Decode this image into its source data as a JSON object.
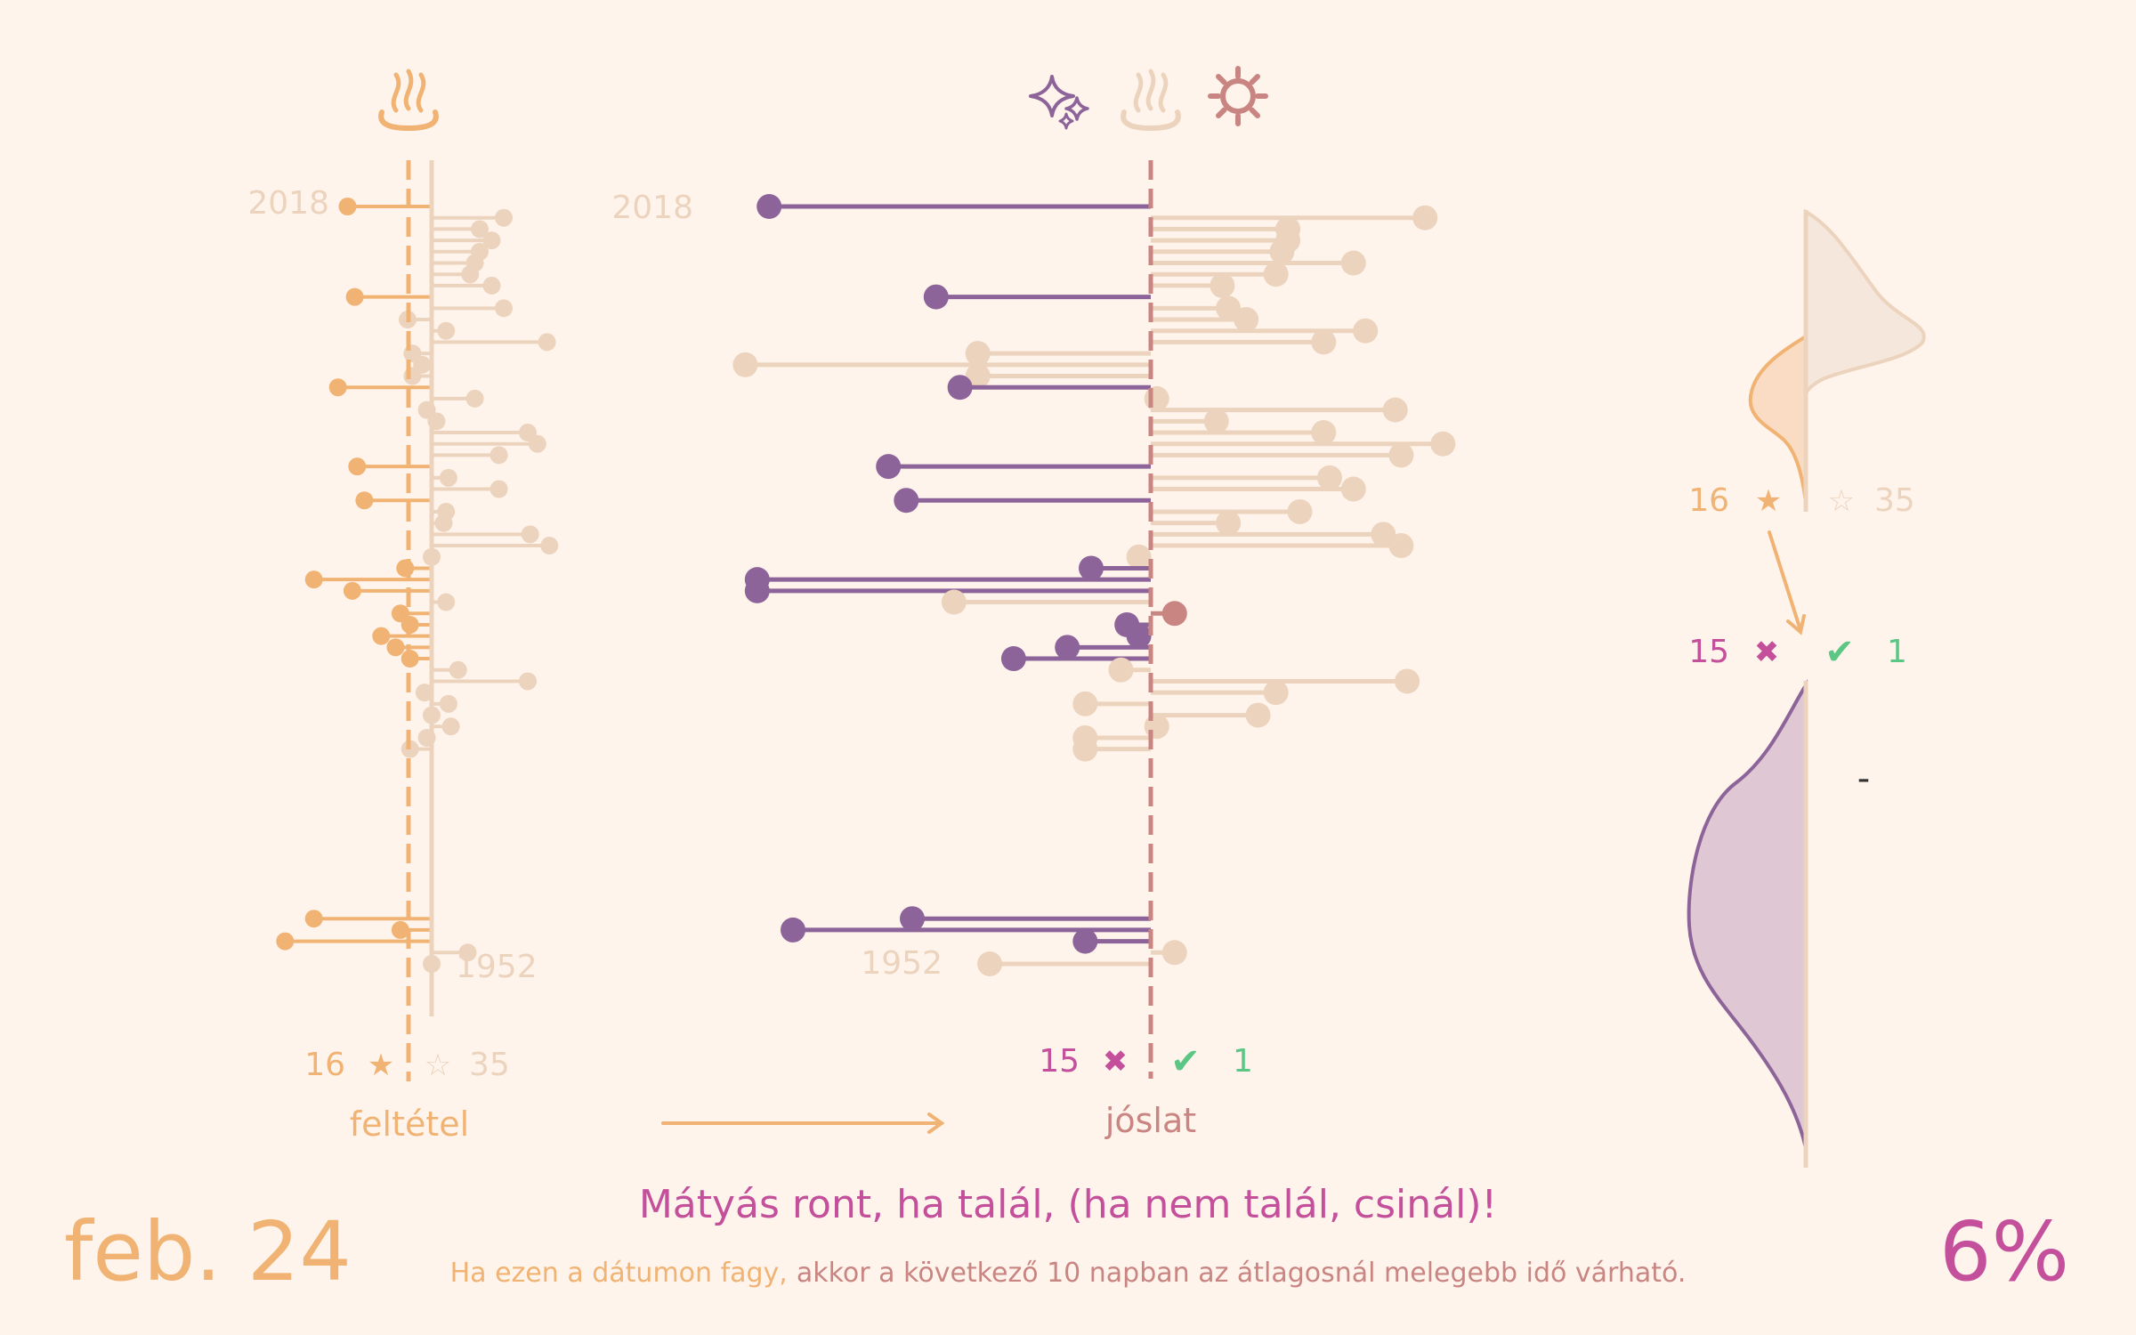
{
  "colors": {
    "background": "#fff4ec",
    "orange": "#f0b373",
    "beige": "#ecd3bd",
    "purple": "#8d6499",
    "rose": "#c98581",
    "magenta": "#c4509b",
    "green": "#5cc785",
    "purple_fill": "#dfc8d3",
    "orange_fill": "#f9dcc3",
    "beige_fill": "#f5e7dc"
  },
  "icons": {
    "condition_icon": "hot-spring-icon",
    "prediction_icons": [
      "sparkles-icon",
      "hot-spring-icon",
      "sun-icon"
    ]
  },
  "labels": {
    "year_top": "2018",
    "year_bottom": "1952",
    "condition_label": "feltétel",
    "prediction_label": "jóslat",
    "dash": "-"
  },
  "counts": {
    "star_filled_count": "16",
    "star_empty_count": "35",
    "star_filled_glyph": "★",
    "star_empty_glyph": "☆",
    "miss_count": "15",
    "hit_count": "1",
    "miss_glyph": "✖",
    "hit_glyph": "✔"
  },
  "footer": {
    "date": "feb. 24",
    "proverb": "Mátyás ront, ha talál, (ha nem talál, csinál)!",
    "explanation_condition": "Ha ezen a dátumon fagy,",
    "explanation_prediction": "akkor a következő 10 napban az átlagosnál melegebb idő várható.",
    "percent": "6%"
  },
  "chart_data": [
    {
      "type": "lollipop",
      "name": "feltétel",
      "x": [
        2018,
        2017,
        2016,
        2015,
        2014,
        2013,
        2012,
        2011,
        2010,
        2009,
        2008,
        2007,
        2006,
        2005,
        2004,
        2003,
        2002,
        2001,
        2000,
        1999,
        1998,
        1997,
        1996,
        1995,
        1994,
        1993,
        1992,
        1991,
        1990,
        1989,
        1988,
        1987,
        1986,
        1985,
        1984,
        1983,
        1982,
        1981,
        1980,
        1979,
        1978,
        1977,
        1976,
        1975,
        1974,
        1973,
        1972,
        1971,
        1970,
        1955,
        1954,
        1953,
        1952,
        1951
      ],
      "values": [
        -3.5,
        3,
        2,
        2.5,
        2,
        1.8,
        1.6,
        2.5,
        -3.2,
        3,
        -1,
        0.6,
        4.8,
        -0.8,
        -0.4,
        -0.8,
        -3.9,
        1.8,
        -0.2,
        0.2,
        4,
        4.4,
        2.8,
        -3.1,
        0.7,
        2.8,
        -2.8,
        0.6,
        0.5,
        4.1,
        4.9,
        0,
        -1.1,
        -4.9,
        -3.3,
        0.6,
        -1.3,
        -0.9,
        -2.1,
        -1.5,
        -0.9,
        1.1,
        4,
        -0.3,
        0.7,
        0,
        0.8,
        -0.2,
        -0.9,
        -4.9,
        -1.3,
        -6.1,
        1.5,
        0
      ],
      "frost": [
        true,
        false,
        false,
        false,
        false,
        false,
        false,
        false,
        true,
        false,
        false,
        false,
        false,
        false,
        false,
        false,
        true,
        false,
        false,
        false,
        false,
        false,
        false,
        true,
        false,
        false,
        true,
        false,
        false,
        false,
        false,
        false,
        true,
        true,
        true,
        false,
        true,
        true,
        true,
        true,
        true,
        false,
        false,
        false,
        false,
        false,
        false,
        false,
        false,
        true,
        true,
        true,
        false,
        false
      ],
      "threshold": 0,
      "ylim": [
        1951,
        2018
      ]
    },
    {
      "type": "lollipop",
      "name": "jóslat",
      "x": [
        2018,
        2017,
        2016,
        2015,
        2014,
        2013,
        2012,
        2011,
        2010,
        2009,
        2008,
        2007,
        2006,
        2005,
        2004,
        2003,
        2002,
        2001,
        2000,
        1999,
        1998,
        1997,
        1996,
        1995,
        1994,
        1993,
        1992,
        1991,
        1990,
        1989,
        1988,
        1987,
        1986,
        1985,
        1984,
        1983,
        1982,
        1981,
        1980,
        1979,
        1978,
        1977,
        1976,
        1975,
        1974,
        1973,
        1972,
        1971,
        1970,
        1955,
        1954,
        1953,
        1952,
        1951
      ],
      "values": [
        -6.4,
        4.6,
        2.3,
        2.3,
        2.2,
        3.4,
        2.1,
        1.2,
        -3.6,
        1.3,
        1.6,
        3.6,
        2.9,
        -2.9,
        -6.8,
        -2.9,
        -3.2,
        0.1,
        4.1,
        1.1,
        2.9,
        4.9,
        4.2,
        -4.4,
        3,
        3.4,
        -4.1,
        2.5,
        1.3,
        3.9,
        4.2,
        -0.2,
        -1.0,
        -6.6,
        -6.6,
        -3.3,
        0.4,
        -0.4,
        -0.2,
        -1.4,
        -2.3,
        -0.5,
        4.3,
        2.1,
        -1.1,
        1.8,
        0.1,
        -1.1,
        -1.1,
        -4.0,
        -6.0,
        -1.1,
        0.4,
        -2.7
      ],
      "misses": 15,
      "hits": 1,
      "threshold": 0,
      "ylim": [
        1951,
        2018
      ]
    },
    {
      "type": "density",
      "name": "feltétel eloszlás",
      "series": [
        {
          "name": "★",
          "count": 16
        },
        {
          "name": "☆",
          "count": 35
        }
      ]
    },
    {
      "type": "density",
      "name": "jóslat eloszlás",
      "series": [
        {
          "name": "✖",
          "count": 15
        },
        {
          "name": "✔",
          "count": 1
        }
      ]
    }
  ]
}
